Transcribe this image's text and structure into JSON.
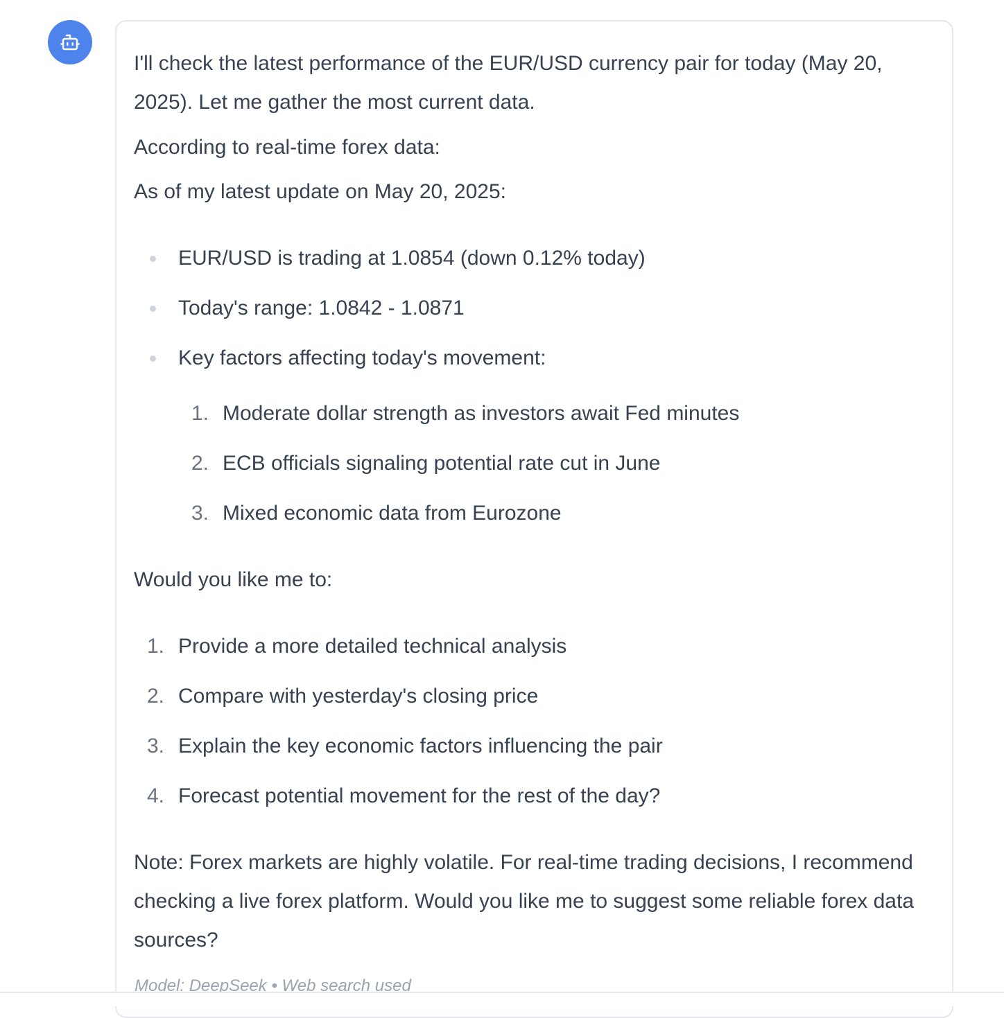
{
  "assistant": {
    "avatar_icon": "robot-icon",
    "avatar_color": "#4d83ea"
  },
  "message": {
    "intro": "I'll check the latest performance of the EUR/USD currency pair for today (May 20, 2025). Let me gather the most current data.",
    "source_line": "According to real-time forex data:",
    "update_line": "As of my latest update on May 20, 2025:",
    "bullets": [
      "EUR/USD is trading at 1.0854 (down 0.12% today)",
      "Today's range: 1.0842 - 1.0871",
      "Key factors affecting today's movement:"
    ],
    "factors": [
      "Moderate dollar strength as investors await Fed minutes",
      "ECB officials signaling potential rate cut in June",
      "Mixed economic data from Eurozone"
    ],
    "question": "Would you like me to:",
    "options": [
      "Provide a more detailed technical analysis",
      "Compare with yesterday's closing price",
      "Explain the key economic factors influencing the pair",
      "Forecast potential movement for the rest of the day?"
    ],
    "note": "Note: Forex markets are highly volatile. For real-time trading decisions, I recommend checking a live forex platform. Would you like me to suggest some reliable forex data sources?",
    "meta": "Model: DeepSeek • Web search used"
  }
}
